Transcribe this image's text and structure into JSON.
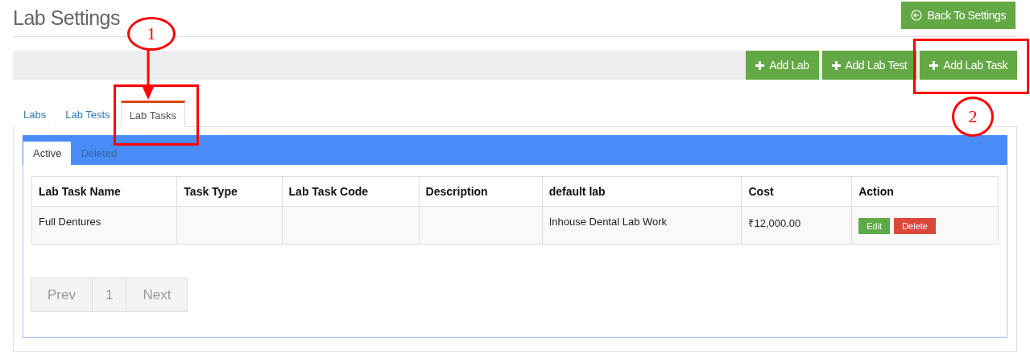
{
  "page_title": "Lab Settings",
  "back_button": {
    "label": "Back To Settings"
  },
  "toolbar_buttons": [
    {
      "label": "Add Lab"
    },
    {
      "label": "Add Lab Test"
    },
    {
      "label": "Add Lab Task"
    }
  ],
  "tabs": [
    {
      "label": "Labs",
      "selected": false
    },
    {
      "label": "Lab Tests",
      "selected": false
    },
    {
      "label": "Lab Tasks",
      "selected": true
    }
  ],
  "subtabs": [
    {
      "label": "Active",
      "selected": true
    },
    {
      "label": "Deleted",
      "selected": false
    }
  ],
  "table": {
    "columns": [
      "Lab Task Name",
      "Task Type",
      "Lab Task Code",
      "Description",
      "default lab",
      "Cost",
      "Action"
    ],
    "rows": [
      {
        "cells": [
          "Full Dentures",
          "",
          "",
          "",
          "Inhouse Dental Lab Work",
          "₹12,000.00"
        ],
        "actions": [
          {
            "kind": "edit",
            "label": "Edit"
          },
          {
            "kind": "delete",
            "label": "Delete"
          }
        ]
      }
    ]
  },
  "pagination": [
    {
      "label": "Prev"
    },
    {
      "label": "1"
    },
    {
      "label": "Next"
    }
  ],
  "annotations": [
    {
      "number": "1",
      "kind": "tab-callout"
    },
    {
      "number": "2",
      "kind": "button-callout"
    }
  ]
}
